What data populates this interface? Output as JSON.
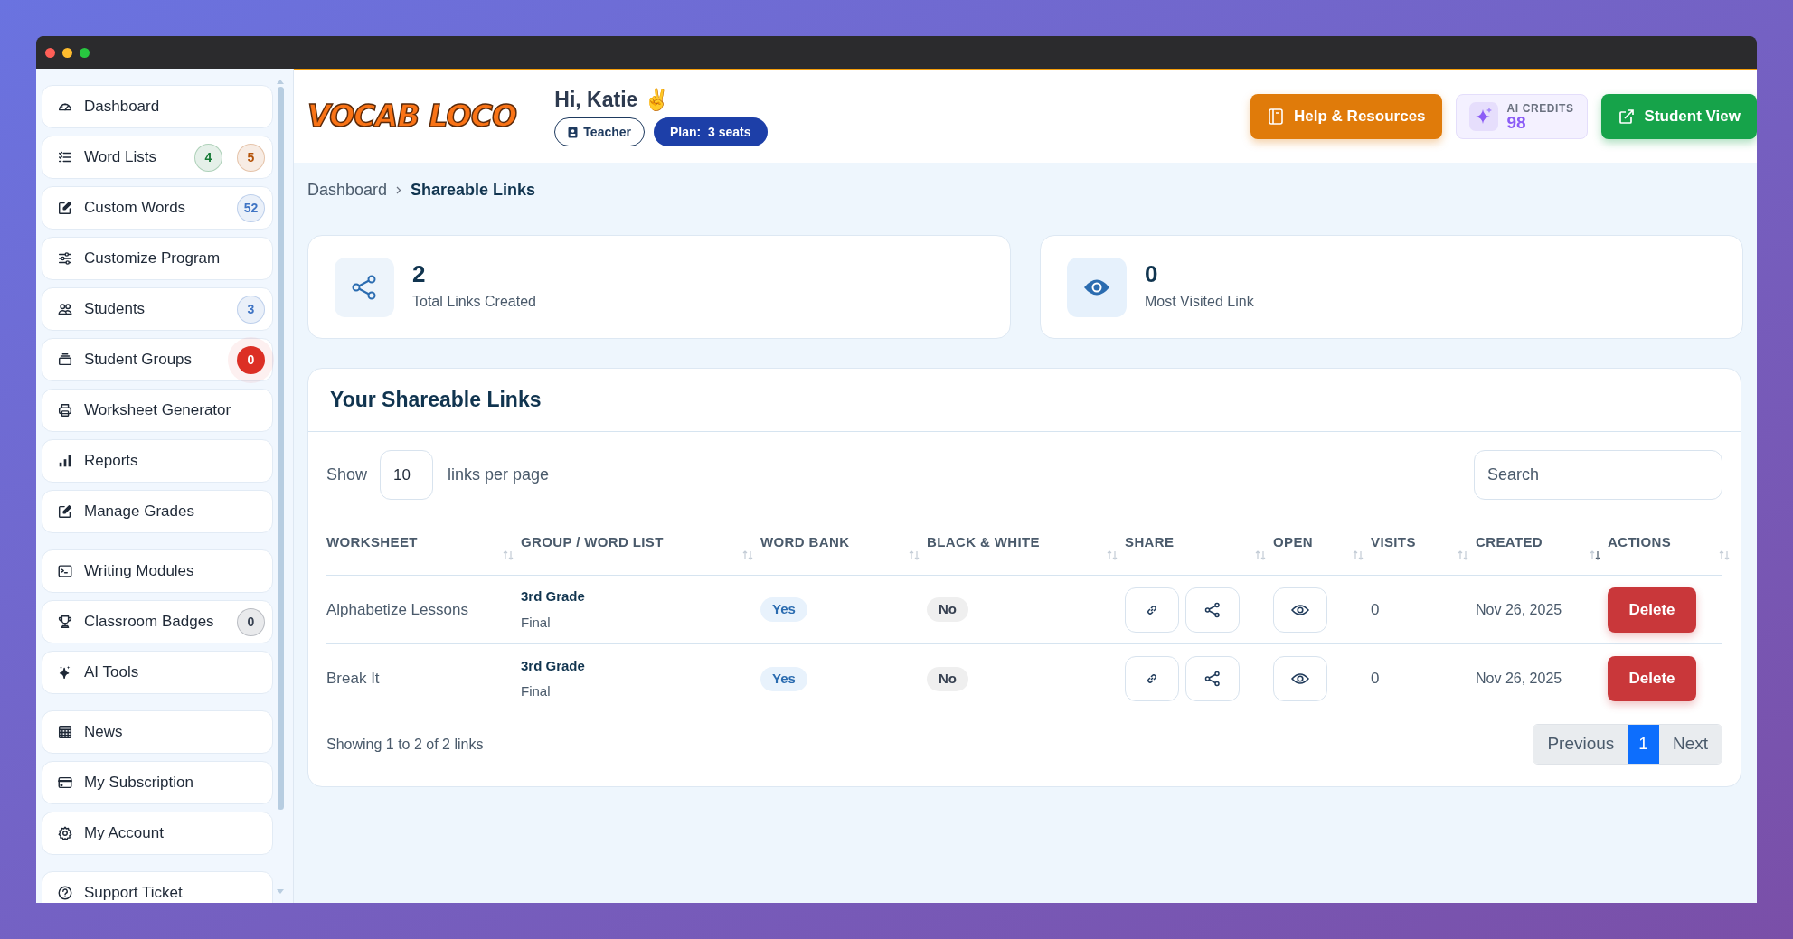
{
  "sidebar": {
    "sections": [
      {
        "items": [
          {
            "label": "Dashboard"
          },
          {
            "label": "Word Lists",
            "badges": [
              {
                "text": "4",
                "kind": "soft",
                "color": "#157a35"
              },
              {
                "text": "5",
                "kind": "soft",
                "color": "#b45309"
              }
            ]
          },
          {
            "label": "Custom Words",
            "badges": [
              {
                "text": "52",
                "kind": "soft",
                "color": "#3f74c4"
              }
            ]
          },
          {
            "label": "Customize Program"
          },
          {
            "label": "Students",
            "badges": [
              {
                "text": "3",
                "kind": "soft",
                "color": "#3f74c4"
              }
            ]
          },
          {
            "label": "Student Groups",
            "badges": [
              {
                "text": "0",
                "kind": "solid",
                "color": "#dc2f25"
              }
            ]
          },
          {
            "label": "Worksheet Generator"
          },
          {
            "label": "Reports"
          },
          {
            "label": "Manage Grades"
          }
        ]
      },
      {
        "items": [
          {
            "label": "Writing Modules"
          },
          {
            "label": "Classroom Badges",
            "badges": [
              {
                "text": "0",
                "kind": "soft",
                "color": "#374151"
              }
            ]
          },
          {
            "label": "AI Tools"
          }
        ]
      },
      {
        "items": [
          {
            "label": "News"
          },
          {
            "label": "My Subscription"
          },
          {
            "label": "My Account"
          }
        ]
      },
      {
        "items": [
          {
            "label": "Support Ticket"
          }
        ]
      }
    ]
  },
  "header": {
    "logo": "VOCAB LOCO",
    "greeting": "Hi, Katie ✌️",
    "role": "Teacher",
    "plan": "Plan:  3 seats",
    "help_button": "Help & Resources",
    "credits_label": "AI CREDITS",
    "credits_value": "98",
    "student_view_button": "Student View"
  },
  "breadcrumb": [
    {
      "label": "Dashboard",
      "current": false
    },
    {
      "label": "Shareable Links",
      "current": true
    }
  ],
  "stats": [
    {
      "value": "2",
      "label": "Total Links Created"
    },
    {
      "value": "0",
      "label": "Most Visited Link"
    }
  ],
  "links_table": {
    "title": "Your Shareable Links",
    "show_label": "Show",
    "per_page": "10",
    "per_page_label": "links per page",
    "search_placeholder": "Search",
    "columns": [
      {
        "label": "WORKSHEET",
        "sorted": false
      },
      {
        "label": "GROUP / WORD LIST",
        "sorted": false
      },
      {
        "label": "WORD BANK",
        "sorted": false
      },
      {
        "label": "BLACK & WHITE",
        "sorted": false
      },
      {
        "label": "SHARE",
        "sorted": false
      },
      {
        "label": "OPEN",
        "sorted": false
      },
      {
        "label": "VISITS",
        "sorted": false
      },
      {
        "label": "CREATED",
        "sorted": true
      },
      {
        "label": "ACTIONS",
        "sorted": false
      }
    ],
    "rows": [
      {
        "worksheet": "Alphabetize Lessons",
        "group": "3rd Grade",
        "word_list": "Final",
        "word_bank": "Yes",
        "black_white": "No",
        "visits": "0",
        "created": "Nov 26, 2025",
        "action": "Delete"
      },
      {
        "worksheet": "Break It",
        "group": "3rd Grade",
        "word_list": "Final",
        "word_bank": "Yes",
        "black_white": "No",
        "visits": "0",
        "created": "Nov 26, 2025",
        "action": "Delete"
      }
    ],
    "summary": "Showing 1 to 2 of 2 links",
    "pagination": [
      {
        "label": "Previous",
        "selected": false
      },
      {
        "label": "1",
        "selected": true
      },
      {
        "label": "Next",
        "selected": false
      }
    ]
  }
}
